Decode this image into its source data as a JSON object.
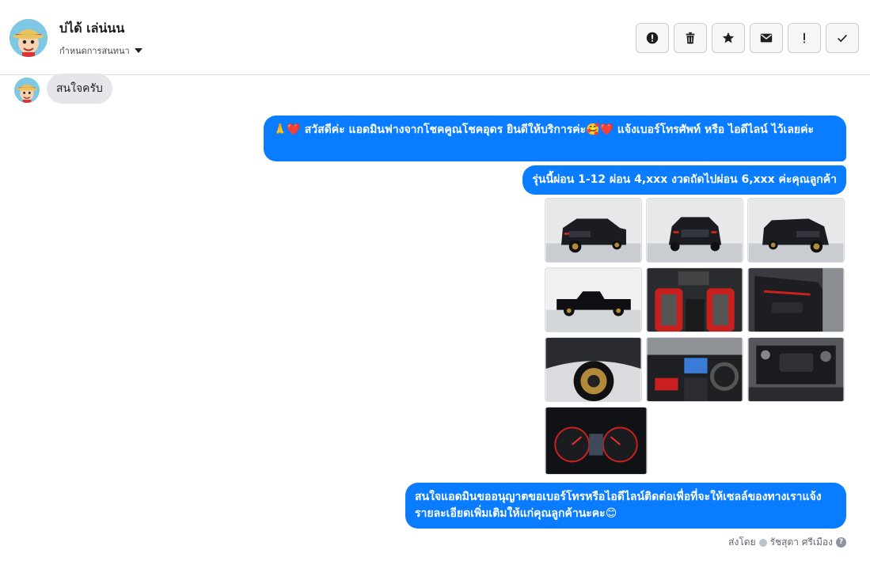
{
  "header": {
    "contact_name": "บ่ได้ เล่น่นน",
    "assign_label": "กำหนดการสนทนา",
    "actions": [
      {
        "name": "alert-circle-icon"
      },
      {
        "name": "trash-icon"
      },
      {
        "name": "star-icon"
      },
      {
        "name": "mail-icon"
      },
      {
        "name": "exclamation-icon"
      },
      {
        "name": "check-icon"
      }
    ]
  },
  "messages": {
    "incoming_1": "สนใจครับ",
    "outgoing_1": "🙏❤️ สวัสดีค่ะ แอดมินฟางจากโชคคูณโชคอุดร ยินดีให้บริการค่ะ🥰❤️ แจ้งเบอร์โทรศัพท์ หรือ ไอดีไลน์  ไว้เลยค่ะ",
    "outgoing_2": "รุ่นนี้ผ่อน 1-12 ผ่อน 4,xxx งวดถัดไปผ่อน 6,xxx ค่ะคุณลูกค้า",
    "outgoing_3": "สนใจแอดมินขออนุญาตขอเบอร์โทรหรือไอดีไลน์ติดต่อเพื่อที่จะให้เซลล์ของทางเราแจ้งรายละเอียดเพิ่มเติมให้แก่คุณลูกค้านะคะ😊"
  },
  "photos": [
    {
      "name": "truck-front-left-photo",
      "kind": "exterior"
    },
    {
      "name": "truck-front-photo",
      "kind": "exterior"
    },
    {
      "name": "truck-front-right-photo",
      "kind": "exterior"
    },
    {
      "name": "truck-side-photo",
      "kind": "side"
    },
    {
      "name": "seats-photo",
      "kind": "interior-red"
    },
    {
      "name": "door-panel-photo",
      "kind": "door"
    },
    {
      "name": "wheel-photo",
      "kind": "wheel"
    },
    {
      "name": "dashboard-photo",
      "kind": "dashboard"
    },
    {
      "name": "engine-photo",
      "kind": "engine"
    },
    {
      "name": "gauge-cluster-photo",
      "kind": "gauges"
    }
  ],
  "footer": {
    "sent_by_label": "ส่งโดย",
    "sender_name": "รัชสุดา ศรีเมือง"
  },
  "colors": {
    "outgoing_bubble": "#0a7cff",
    "incoming_bubble": "#e4e6eb"
  }
}
